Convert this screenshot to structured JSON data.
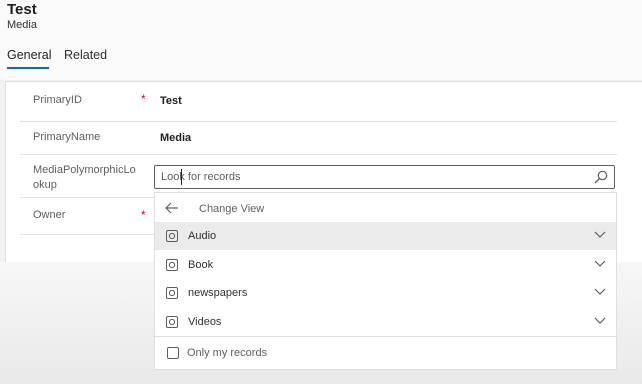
{
  "header": {
    "title": "Test",
    "subtitle": "Media"
  },
  "tabs": [
    {
      "label": "General",
      "active": true
    },
    {
      "label": "Related",
      "active": false
    }
  ],
  "form": {
    "fields": [
      {
        "label": "PrimaryID",
        "value": "Test",
        "required": true
      },
      {
        "label": "PrimaryName",
        "value": "Media",
        "required": false
      },
      {
        "label": "MediaPolymorphicLookup",
        "label_line1": "MediaPolymorphicLo",
        "label_line2": "okup",
        "value": "",
        "required": false
      },
      {
        "label": "Owner",
        "value": "",
        "required": true
      }
    ],
    "required_marker": "*"
  },
  "lookup": {
    "placeholder": "Look for records",
    "change_view_label": "Change View",
    "entities": [
      {
        "label": "Audio",
        "hovered": true
      },
      {
        "label": "Book",
        "hovered": false
      },
      {
        "label": "newspapers",
        "hovered": false
      },
      {
        "label": "Videos",
        "hovered": false
      }
    ],
    "only_my_records_label": "Only my records",
    "only_my_records_checked": false
  },
  "colors": {
    "accent": "#0f6cbd",
    "required": "#c50f1f",
    "hover_row": "#ebebeb"
  },
  "icons": [
    "search-icon",
    "back-arrow-icon",
    "entity-icon",
    "chevron-down-icon",
    "checkbox-icon"
  ]
}
